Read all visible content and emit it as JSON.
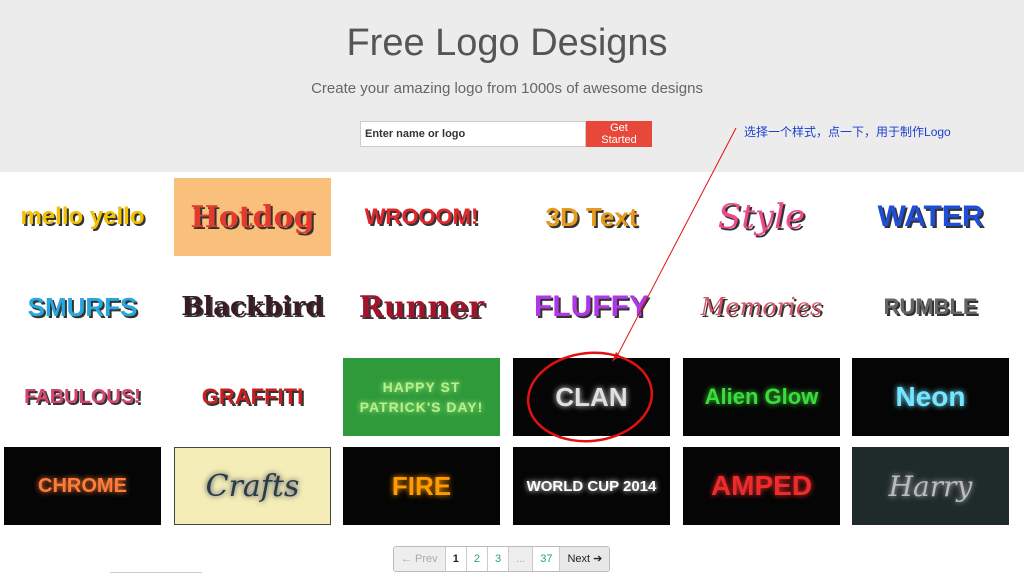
{
  "header": {
    "title": "Free Logo Designs",
    "subtitle": "Create your amazing logo from 1000s of awesome designs"
  },
  "search": {
    "placeholder": "Enter name or logo",
    "button_label": "Get Started"
  },
  "annotation": {
    "note_cn": "选择一个样式，点一下，用于制作",
    "note_en": "Logo"
  },
  "logos": [
    {
      "label": "mello yello",
      "fg": "#f2c200",
      "bg": "#ffffff"
    },
    {
      "label": "Hotdog",
      "fg": "#e23b2e",
      "bg": "#f8c07a"
    },
    {
      "label": "WROOOM!",
      "fg": "#e3262b",
      "bg": "#ffffff"
    },
    {
      "label": "3D Text",
      "fg": "#e89a1c",
      "bg": "#ffffff"
    },
    {
      "label": "Style",
      "fg": "#f0488d",
      "bg": "#ffffff"
    },
    {
      "label": "WATER",
      "fg": "#1f4fd8",
      "bg": "#ffffff"
    },
    {
      "label": "SMURFS",
      "fg": "#29a8e0",
      "bg": "#ffffff"
    },
    {
      "label": "Blackbird",
      "fg": "#3a1b22",
      "bg": "#ffffff"
    },
    {
      "label": "Runner",
      "fg": "#a2132c",
      "bg": "#ffffff"
    },
    {
      "label": "FLUFFY",
      "fg": "#b036e6",
      "bg": "#ffffff"
    },
    {
      "label": "Memories",
      "fg": "#d45567",
      "bg": "#ffffff"
    },
    {
      "label": "RUMBLE",
      "fg": "#666666",
      "bg": "#ffffff"
    },
    {
      "label": "FABULOUS!",
      "fg": "#d6456e",
      "bg": "#ffffff"
    },
    {
      "label": "GRAFFITI",
      "fg": "#c82020",
      "bg": "#ffffff"
    },
    {
      "label": "HAPPY ST PATRICK'S DAY!",
      "fg": "#b6f28a",
      "bg": "#2f9a3a"
    },
    {
      "label": "CLAN",
      "fg": "#e0e0e0",
      "bg": "#050505"
    },
    {
      "label": "Alien Glow",
      "fg": "#3bdc3b",
      "bg": "#050505"
    },
    {
      "label": "Neon",
      "fg": "#74e6ff",
      "bg": "#050505"
    },
    {
      "label": "CHROME",
      "fg": "#ff7b3a",
      "bg": "#050505"
    },
    {
      "label": "Crafts",
      "fg": "#2a3a4a",
      "bg": "#f5edb8"
    },
    {
      "label": "FIRE",
      "fg": "#ff9a00",
      "bg": "#050505"
    },
    {
      "label": "WORLD CUP 2014",
      "fg": "#ffffff",
      "bg": "#050505"
    },
    {
      "label": "AMPED",
      "fg": "#ee2b2b",
      "bg": "#050505"
    },
    {
      "label": "Harry",
      "fg": "#bbbbbb",
      "bg": "#1f2a2a"
    }
  ],
  "pagination": {
    "prev": "← Prev",
    "pages": [
      "1",
      "2",
      "3",
      "...",
      "37"
    ],
    "next": "Next ➔"
  },
  "colors": {
    "accent": "#e8483a",
    "annotation": "#1a3fd1",
    "circle": "#e11111"
  }
}
